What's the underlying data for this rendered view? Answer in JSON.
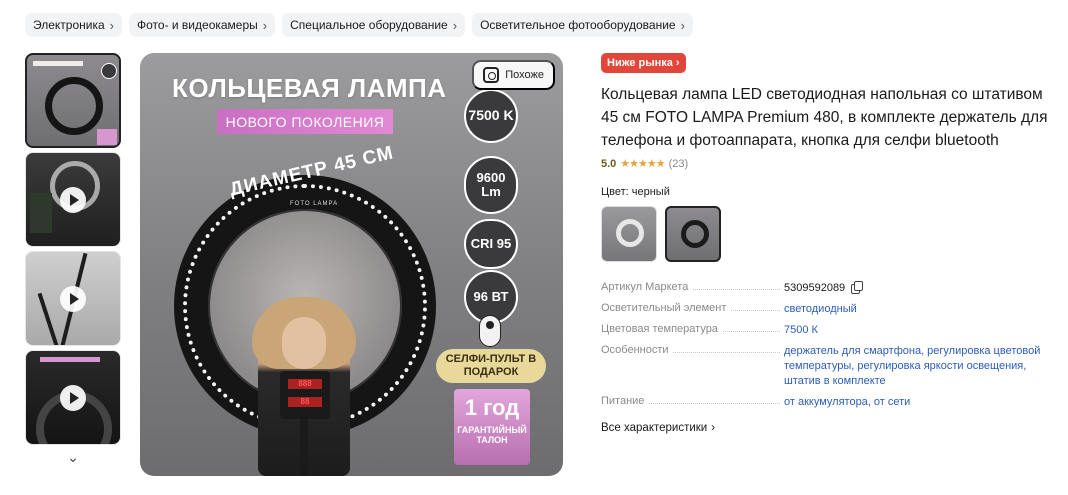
{
  "breadcrumbs": [
    {
      "label": "Электроника"
    },
    {
      "label": "Фото- и видеокамеры"
    },
    {
      "label": "Специальное оборудование"
    },
    {
      "label": "Осветительное фотооборудование"
    }
  ],
  "gallery": {
    "similar_label": "Похоже",
    "promo": {
      "title": "КОЛЬЦЕВАЯ ЛАМПА",
      "subtitle": "НОВОГО ПОКОЛЕНИЯ",
      "diameter": "ДИАМЕТР 45 СМ",
      "ring_logo": "FOTO LAMPA",
      "specs": [
        "7500 K",
        "9600 Lm",
        "CRI 95",
        "96 ВТ"
      ],
      "selfie": "СЕЛФИ-ПУЛЬТ В ПОДАРОК",
      "warranty_big": "1 год",
      "warranty_small": "ГАРАНТИЙНЫЙ ТАЛОН",
      "panel_display_1": "888",
      "panel_display_2": "88"
    }
  },
  "product": {
    "badge": "Ниже рынка",
    "title": "Кольцевая лампа LED светодиодная напольная со штативом 45 см FOTO LAMPA Premium 480, в комплекте держатель для телефона и фотоаппарата, кнопка для селфи bluetooth",
    "rating": "5.0",
    "stars": "★★★★★",
    "reviews": "(23)",
    "color_label": "Цвет: черный"
  },
  "specs": [
    {
      "key": "Артикул Маркета",
      "value": "5309592089"
    },
    {
      "key": "Осветительный элемент",
      "value": "светодиодный"
    },
    {
      "key": "Цветовая температура",
      "value": "7500 К"
    },
    {
      "key": "Особенности",
      "value": "держатель для смартфона, регулировка цветовой температуры, регулировка яркости освещения, штатив в комплекте"
    },
    {
      "key": "Питание",
      "value": "от аккумулятора, от сети"
    }
  ],
  "all_specs_link": "Все характеристики",
  "colors": {
    "badge": "#e0473a",
    "link": "#2c5db6",
    "stars": "#e8a33a"
  }
}
